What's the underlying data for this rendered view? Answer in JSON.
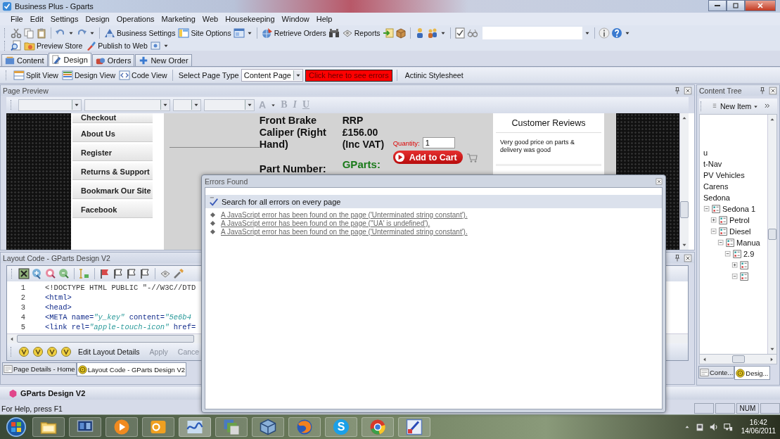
{
  "window": {
    "title": "Business Plus - Gparts"
  },
  "menu": [
    "File",
    "Edit",
    "Settings",
    "Design",
    "Operations",
    "Marketing",
    "Web",
    "Housekeeping",
    "Window",
    "Help"
  ],
  "toolbar": {
    "buttons": [
      "Business Settings",
      "Site Options",
      "Retrieve Orders",
      "Reports"
    ]
  },
  "toolbar_2": {
    "buttons": [
      "Preview Store",
      "Publish to Web"
    ]
  },
  "tabs": [
    {
      "label": "Content",
      "selected": false
    },
    {
      "label": "Design",
      "selected": true
    },
    {
      "label": "Orders",
      "selected": false
    },
    {
      "label": "New Order",
      "selected": false
    }
  ],
  "design_toolbar": {
    "views": [
      "Split View",
      "Design View",
      "Code View"
    ],
    "page_type_label": "Select Page Type",
    "page_type": "Content Page",
    "errors_button": "Click here to see errors",
    "stylesheet": "Actinic Stylesheet"
  },
  "page_preview": {
    "title": "Page Preview",
    "format": [
      {
        "label": "A",
        "disabled": true
      },
      {
        "label": "B",
        "disabled": true
      },
      {
        "label": "I",
        "disabled": true
      },
      {
        "label": "U",
        "disabled": true
      }
    ],
    "nav": [
      "Checkout",
      "About Us",
      "Register",
      "Returns & Support",
      "Bookmark Our Site",
      "Facebook"
    ],
    "product": {
      "name": "Front Brake Caliper (Right Hand)",
      "price": "RRP £156.00 (Inc VAT)",
      "quantity_label": "Quantity:",
      "quantity": "1",
      "add_to_cart": "Add to Cart",
      "part_number_label": "Part Number:",
      "part_number": "GParts:"
    },
    "reviews": {
      "title": "Customer Reviews",
      "text": "Very good price on parts & delivery was good"
    }
  },
  "layout_code": {
    "title": "Layout Code - GParts Design V2",
    "lines": [
      {
        "number": "1",
        "code": "<!DOCTYPE HTML PUBLIC \"-//W3C//DTD",
        "kind": "doctype"
      },
      {
        "number": "2",
        "code": "<html>",
        "kind": "tag"
      },
      {
        "number": "3",
        "code": "<head>",
        "kind": "tag"
      },
      {
        "number": "4",
        "code": "<META name=\"y_key\" content=\"5e6b4",
        "kind": "tag"
      },
      {
        "number": "5",
        "code": "<link rel=\"apple-touch-icon\" href=",
        "kind": "tag"
      }
    ],
    "actions": [
      {
        "label": "Edit Layout Details",
        "disabled": false
      },
      {
        "label": "Apply",
        "disabled": true
      },
      {
        "label": "Cance",
        "disabled": true
      }
    ],
    "tabs": [
      {
        "label": "Page Details - Home",
        "selected": false
      },
      {
        "label": "Layout Code - GParts Design V2",
        "selected": true
      }
    ]
  },
  "content_tree": {
    "title": "Content Tree",
    "new_item": "New Item",
    "items": [
      {
        "label": "u"
      },
      {
        "label": "t-Nav"
      },
      {
        "label": "PV Vehicles"
      },
      {
        "label": "Carens"
      },
      {
        "label": "Sedona"
      },
      {
        "label": "Sedona 1",
        "expanded": true,
        "children": [
          {
            "label": "Petrol",
            "expanded": false
          },
          {
            "label": "Diesel",
            "expanded": true,
            "children": [
              {
                "label": "Manua",
                "expanded": true,
                "children": [
                  {
                    "label": "2.9",
                    "expanded": true,
                    "children": [
                      {
                        "expanded": false
                      },
                      {
                        "expanded": true
                      }
                    ]
                  }
                ]
              }
            ]
          }
        ]
      }
    ],
    "tabs": [
      {
        "label": "Conte...",
        "selected": false
      },
      {
        "label": "Desig...",
        "selected": true
      }
    ]
  },
  "errors_dialog": {
    "title": "Errors Found",
    "search": "Search for all errors on every page",
    "errors": [
      "A JavaScript error has been found on the page ('Unterminated string constant').",
      "A JavaScript error has been found on the page (''UA' is undefined').",
      "A JavaScript error has been found on the page ('Unterminated string constant')."
    ]
  },
  "design_bar": "GParts Design V2",
  "status_bar": {
    "help": "For Help, press F1",
    "indicators": [
      "NUM"
    ]
  },
  "taskbar": {
    "skype_letter": "S",
    "time": "16:42",
    "date": "14/06/2011"
  }
}
